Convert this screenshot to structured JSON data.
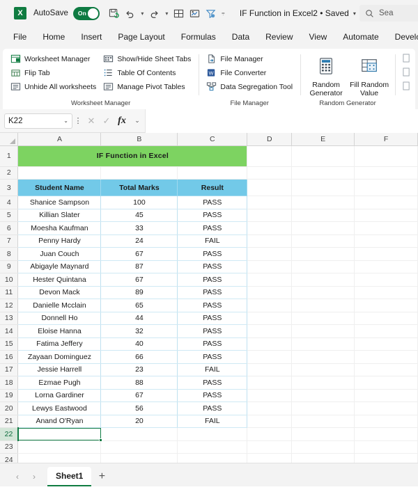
{
  "titlebar": {
    "app_icon": "excel-logo",
    "autosave_label": "AutoSave",
    "autosave_state": "On",
    "document_title": "IF Function in Excel2 • Saved",
    "quick_access": [
      {
        "name": "save-refresh-icon"
      },
      {
        "name": "undo-icon"
      },
      {
        "name": "redo-icon"
      },
      {
        "name": "table-icon"
      },
      {
        "name": "chart-export-icon"
      },
      {
        "name": "filter-icon"
      },
      {
        "name": "more-commands-icon"
      }
    ],
    "search_placeholder": "Sea"
  },
  "ribbon": {
    "tabs": [
      {
        "label": "File",
        "active": false
      },
      {
        "label": "Home",
        "active": false
      },
      {
        "label": "Insert",
        "active": false
      },
      {
        "label": "Page Layout",
        "active": false
      },
      {
        "label": "Formulas",
        "active": false
      },
      {
        "label": "Data",
        "active": false
      },
      {
        "label": "Review",
        "active": false
      },
      {
        "label": "View",
        "active": false
      },
      {
        "label": "Automate",
        "active": false
      },
      {
        "label": "Developer",
        "active": false
      }
    ],
    "groups": [
      {
        "label": "Worksheet Manager",
        "col1": [
          "Worksheet Manager",
          "Flip Tab",
          "Unhide All worksheets"
        ],
        "col2": [
          "Show/Hide Sheet Tabs",
          "Table Of Contents",
          "Manage Pivot Tables"
        ]
      },
      {
        "label": "File Manager",
        "col1": [
          "File Manager",
          "File Converter",
          "Data Segregation Tool"
        ]
      },
      {
        "label": "Random Generator",
        "big": [
          "Random Generator",
          "Fill Random Value"
        ]
      }
    ]
  },
  "formula_bar": {
    "name_box_value": "K22",
    "cancel_icon": "close-icon",
    "confirm_icon": "check-icon",
    "fx_label": "fx",
    "formula_value": ""
  },
  "grid": {
    "column_headers": [
      "A",
      "B",
      "C",
      "D",
      "E",
      "F"
    ],
    "row_numbers": [
      "1",
      "2",
      "3",
      "4",
      "5",
      "6",
      "7",
      "8",
      "9",
      "10",
      "11",
      "12",
      "13",
      "14",
      "15",
      "16",
      "17",
      "18",
      "19",
      "20",
      "21",
      "22",
      "23",
      "24"
    ],
    "selected_row": "22",
    "sheet_title": "IF Function in Excel",
    "table_headers": [
      "Student Name",
      "Total Marks",
      "Result"
    ],
    "rows": [
      {
        "name": "Shanice Sampson",
        "marks": "100",
        "result": "PASS"
      },
      {
        "name": "Killian Slater",
        "marks": "45",
        "result": "PASS"
      },
      {
        "name": "Moesha Kaufman",
        "marks": "33",
        "result": "PASS"
      },
      {
        "name": "Penny Hardy",
        "marks": "24",
        "result": "FAIL"
      },
      {
        "name": "Juan Couch",
        "marks": "67",
        "result": "PASS"
      },
      {
        "name": "Abigayle Maynard",
        "marks": "87",
        "result": "PASS"
      },
      {
        "name": "Hester Quintana",
        "marks": "67",
        "result": "PASS"
      },
      {
        "name": "Devon Mack",
        "marks": "89",
        "result": "PASS"
      },
      {
        "name": "Danielle Mcclain",
        "marks": "65",
        "result": "PASS"
      },
      {
        "name": "Donnell Ho",
        "marks": "44",
        "result": "PASS"
      },
      {
        "name": "Eloise Hanna",
        "marks": "32",
        "result": "PASS"
      },
      {
        "name": "Fatima Jeffery",
        "marks": "40",
        "result": "PASS"
      },
      {
        "name": "Zayaan Dominguez",
        "marks": "66",
        "result": "PASS"
      },
      {
        "name": "Jessie Harrell",
        "marks": "23",
        "result": "FAIL"
      },
      {
        "name": "Ezmae Pugh",
        "marks": "88",
        "result": "PASS"
      },
      {
        "name": "Lorna Gardiner",
        "marks": "67",
        "result": "PASS"
      },
      {
        "name": "Lewys Eastwood",
        "marks": "56",
        "result": "PASS"
      },
      {
        "name": "Anand O'Ryan",
        "marks": "20",
        "result": "FAIL"
      }
    ],
    "colors": {
      "title_fill": "#7dd361",
      "header_fill": "#72c9e8",
      "header_text": "#17365d",
      "selection": "#0f7b43"
    }
  },
  "sheetbar": {
    "prev_icon": "chevron-left-icon",
    "next_icon": "chevron-right-icon",
    "sheets": [
      {
        "label": "Sheet1",
        "active": true
      }
    ],
    "add_label": "+"
  }
}
